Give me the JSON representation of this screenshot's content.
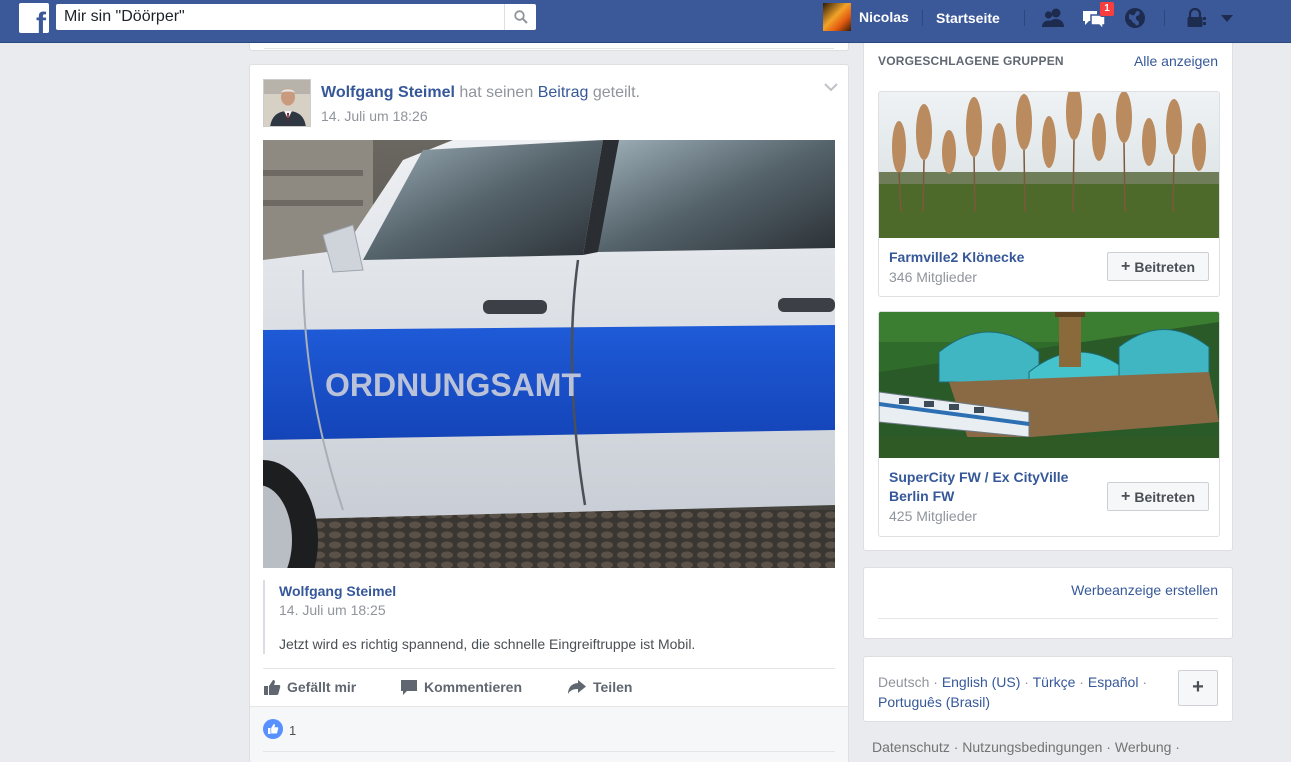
{
  "topbar": {
    "search_value": "Mir sin \"Döörper\"",
    "user_name": "Nicolas",
    "home_label": "Startseite",
    "notification_count": "1"
  },
  "post": {
    "author": "Wolfgang Steimel",
    "action_text": "hat seinen",
    "action_link": "Beitrag",
    "action_suffix": "geteilt.",
    "time": "14. Juli um 18:26",
    "image_text": "ORDNUNGSAMT",
    "shared": {
      "author": "Wolfgang Steimel",
      "time": "14. Juli um 18:25",
      "text": "Jetzt wird es richtig spannend, die schnelle Eingreiftruppe ist Mobil."
    },
    "actions": {
      "like": "Gefällt mir",
      "comment": "Kommentieren",
      "share": "Teilen"
    },
    "like_count": "1"
  },
  "groups": {
    "title": "VORGESCHLAGENE GRUPPEN",
    "see_all": "Alle anzeigen",
    "items": [
      {
        "name": "Farmville2 Klönecke",
        "members": "346 Mitglieder",
        "join_label": "Beitreten"
      },
      {
        "name": "SuperCity FW / Ex CityVille Berlin FW",
        "members": "425 Mitglieder",
        "join_label": "Beitreten"
      }
    ]
  },
  "ads": {
    "create_label": "Werbeanzeige erstellen"
  },
  "languages": {
    "current": "Deutsch",
    "options": [
      "English (US)",
      "Türkçe",
      "Español",
      "Português (Brasil)"
    ]
  },
  "footer": {
    "links": [
      "Datenschutz",
      "Nutzungsbedingungen",
      "Werbung"
    ]
  },
  "colors": {
    "brand_blue": "#3b5998",
    "link_blue": "#365899",
    "badge_red": "#fa3e3e",
    "page_bg": "#e9ebee"
  }
}
